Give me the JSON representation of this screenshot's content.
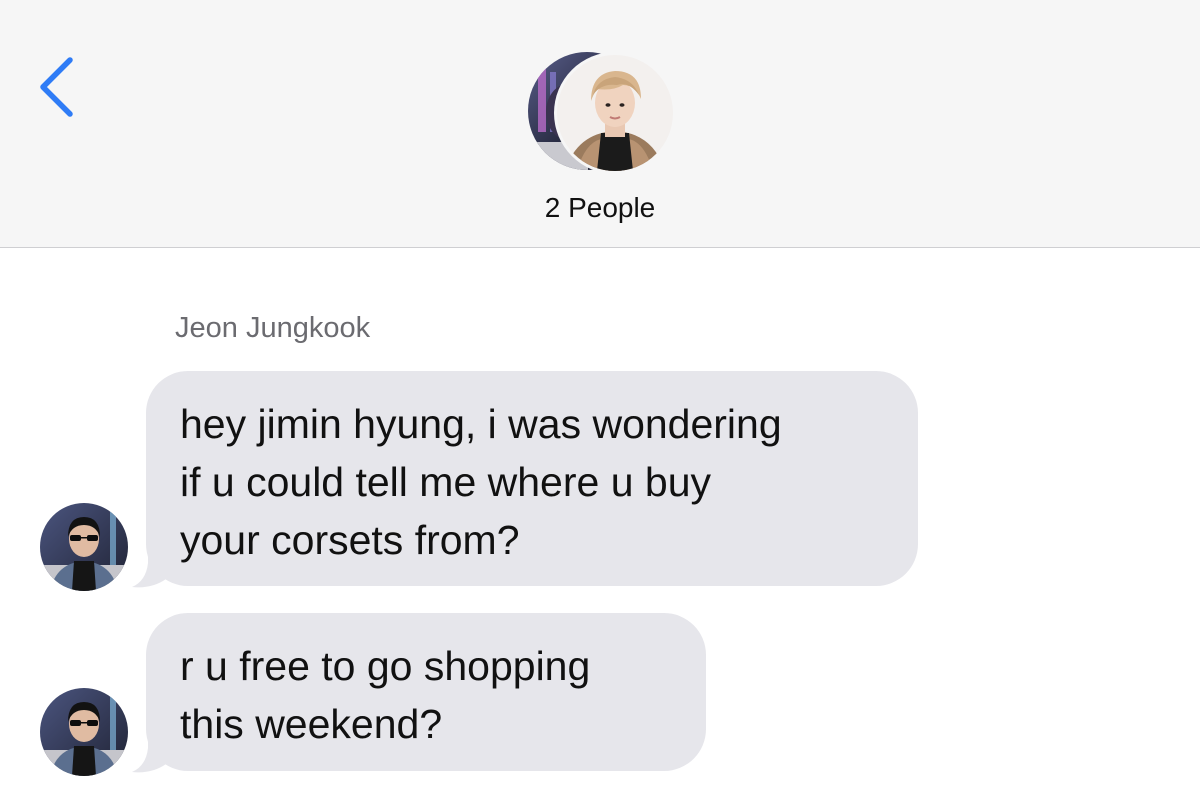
{
  "header": {
    "group_title": "2 People"
  },
  "conversation": {
    "sender_name": "Jeon Jungkook",
    "messages": [
      {
        "lines": [
          "hey jimin hyung, i was wondering",
          "if u could tell me where u buy",
          "your corsets from?"
        ]
      },
      {
        "lines": [
          "r u free to go shopping",
          "this weekend?"
        ]
      }
    ]
  },
  "icons": {
    "back": "chevron-left-icon"
  },
  "colors": {
    "accent": "#2f7cf6",
    "header_bg": "#f6f6f6",
    "bubble_bg": "#e6e6eb",
    "sender_name": "#6b6b70",
    "text": "#111111"
  }
}
